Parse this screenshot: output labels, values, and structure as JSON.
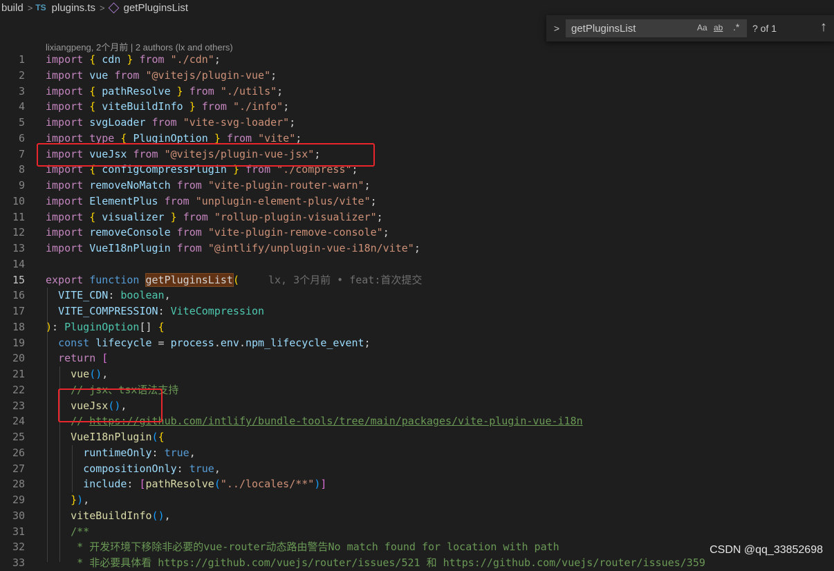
{
  "breadcrumb": {
    "folder": "build",
    "file_icon": "TS",
    "file": "plugins.ts",
    "symbol": "getPluginsList"
  },
  "find": {
    "query": "getPluginsList",
    "match_case": "Aa",
    "whole_word": "ab",
    "regex": ".*",
    "count": "? of 1"
  },
  "blame_header": "lixiangpeng, 2个月前 | 2 authors (lx and others)",
  "inline_blame": "lx, 3个月前 • feat:首次提交",
  "lines": [
    [
      [
        "c",
        "import"
      ],
      [
        "p",
        " "
      ],
      [
        "b1",
        "{"
      ],
      [
        "p",
        " "
      ],
      [
        "v",
        "cdn"
      ],
      [
        "p",
        " "
      ],
      [
        "b1",
        "}"
      ],
      [
        "p",
        " "
      ],
      [
        "c",
        "from"
      ],
      [
        "p",
        " "
      ],
      [
        "s",
        "\"./cdn\""
      ],
      [
        "p",
        ";"
      ]
    ],
    [
      [
        "c",
        "import"
      ],
      [
        "p",
        " "
      ],
      [
        "v",
        "vue"
      ],
      [
        "p",
        " "
      ],
      [
        "c",
        "from"
      ],
      [
        "p",
        " "
      ],
      [
        "s",
        "\"@vitejs/plugin-vue\""
      ],
      [
        "p",
        ";"
      ]
    ],
    [
      [
        "c",
        "import"
      ],
      [
        "p",
        " "
      ],
      [
        "b1",
        "{"
      ],
      [
        "p",
        " "
      ],
      [
        "v",
        "pathResolve"
      ],
      [
        "p",
        " "
      ],
      [
        "b1",
        "}"
      ],
      [
        "p",
        " "
      ],
      [
        "c",
        "from"
      ],
      [
        "p",
        " "
      ],
      [
        "s",
        "\"./utils\""
      ],
      [
        "p",
        ";"
      ]
    ],
    [
      [
        "c",
        "import"
      ],
      [
        "p",
        " "
      ],
      [
        "b1",
        "{"
      ],
      [
        "p",
        " "
      ],
      [
        "v",
        "viteBuildInfo"
      ],
      [
        "p",
        " "
      ],
      [
        "b1",
        "}"
      ],
      [
        "p",
        " "
      ],
      [
        "c",
        "from"
      ],
      [
        "p",
        " "
      ],
      [
        "s",
        "\"./info\""
      ],
      [
        "p",
        ";"
      ]
    ],
    [
      [
        "c",
        "import"
      ],
      [
        "p",
        " "
      ],
      [
        "v",
        "svgLoader"
      ],
      [
        "p",
        " "
      ],
      [
        "c",
        "from"
      ],
      [
        "p",
        " "
      ],
      [
        "s",
        "\"vite-svg-loader\""
      ],
      [
        "p",
        ";"
      ]
    ],
    [
      [
        "c",
        "import"
      ],
      [
        "p",
        " "
      ],
      [
        "c",
        "type"
      ],
      [
        "p",
        " "
      ],
      [
        "b1",
        "{"
      ],
      [
        "p",
        " "
      ],
      [
        "v",
        "PluginOption"
      ],
      [
        "p",
        " "
      ],
      [
        "b1",
        "}"
      ],
      [
        "p",
        " "
      ],
      [
        "c",
        "from"
      ],
      [
        "p",
        " "
      ],
      [
        "s",
        "\"vite\""
      ],
      [
        "p",
        ";"
      ]
    ],
    [
      [
        "c",
        "import"
      ],
      [
        "p",
        " "
      ],
      [
        "v",
        "vueJsx"
      ],
      [
        "p",
        " "
      ],
      [
        "c",
        "from"
      ],
      [
        "p",
        " "
      ],
      [
        "s",
        "\"@vitejs/plugin-vue-jsx\""
      ],
      [
        "p",
        ";"
      ]
    ],
    [
      [
        "c",
        "import"
      ],
      [
        "p",
        " "
      ],
      [
        "b1",
        "{"
      ],
      [
        "p",
        " "
      ],
      [
        "v",
        "configCompressPlugin"
      ],
      [
        "p",
        " "
      ],
      [
        "b1",
        "}"
      ],
      [
        "p",
        " "
      ],
      [
        "c",
        "from"
      ],
      [
        "p",
        " "
      ],
      [
        "s",
        "\"./compress\""
      ],
      [
        "p",
        ";"
      ]
    ],
    [
      [
        "c",
        "import"
      ],
      [
        "p",
        " "
      ],
      [
        "v",
        "removeNoMatch"
      ],
      [
        "p",
        " "
      ],
      [
        "c",
        "from"
      ],
      [
        "p",
        " "
      ],
      [
        "s",
        "\"vite-plugin-router-warn\""
      ],
      [
        "p",
        ";"
      ]
    ],
    [
      [
        "c",
        "import"
      ],
      [
        "p",
        " "
      ],
      [
        "v",
        "ElementPlus"
      ],
      [
        "p",
        " "
      ],
      [
        "c",
        "from"
      ],
      [
        "p",
        " "
      ],
      [
        "s",
        "\"unplugin-element-plus/vite\""
      ],
      [
        "p",
        ";"
      ]
    ],
    [
      [
        "c",
        "import"
      ],
      [
        "p",
        " "
      ],
      [
        "b1",
        "{"
      ],
      [
        "p",
        " "
      ],
      [
        "v",
        "visualizer"
      ],
      [
        "p",
        " "
      ],
      [
        "b1",
        "}"
      ],
      [
        "p",
        " "
      ],
      [
        "c",
        "from"
      ],
      [
        "p",
        " "
      ],
      [
        "s",
        "\"rollup-plugin-visualizer\""
      ],
      [
        "p",
        ";"
      ]
    ],
    [
      [
        "c",
        "import"
      ],
      [
        "p",
        " "
      ],
      [
        "v",
        "removeConsole"
      ],
      [
        "p",
        " "
      ],
      [
        "c",
        "from"
      ],
      [
        "p",
        " "
      ],
      [
        "s",
        "\"vite-plugin-remove-console\""
      ],
      [
        "p",
        ";"
      ]
    ],
    [
      [
        "c",
        "import"
      ],
      [
        "p",
        " "
      ],
      [
        "v",
        "VueI18nPlugin"
      ],
      [
        "p",
        " "
      ],
      [
        "c",
        "from"
      ],
      [
        "p",
        " "
      ],
      [
        "s",
        "\"@intlify/unplugin-vue-i18n/vite\""
      ],
      [
        "p",
        ";"
      ]
    ],
    [],
    [
      [
        "c",
        "export"
      ],
      [
        "p",
        " "
      ],
      [
        "k",
        "function"
      ],
      [
        "p",
        " "
      ],
      [
        "hl",
        "getPluginsList"
      ],
      [
        "b1",
        "("
      ],
      [
        "blame",
        ""
      ]
    ],
    [
      [
        "p",
        "  "
      ],
      [
        "v",
        "VITE_CDN"
      ],
      [
        "p",
        ": "
      ],
      [
        "t",
        "boolean"
      ],
      [
        "p",
        ","
      ]
    ],
    [
      [
        "p",
        "  "
      ],
      [
        "v",
        "VITE_COMPRESSION"
      ],
      [
        "p",
        ": "
      ],
      [
        "t",
        "ViteCompression"
      ]
    ],
    [
      [
        "b1",
        ")"
      ],
      [
        "p",
        ": "
      ],
      [
        "t",
        "PluginOption"
      ],
      [
        "p",
        "[] "
      ],
      [
        "b1",
        "{"
      ]
    ],
    [
      [
        "p",
        "  "
      ],
      [
        "k",
        "const"
      ],
      [
        "p",
        " "
      ],
      [
        "v",
        "lifecycle"
      ],
      [
        "p",
        " = "
      ],
      [
        "v",
        "process"
      ],
      [
        "p",
        "."
      ],
      [
        "v",
        "env"
      ],
      [
        "p",
        "."
      ],
      [
        "v",
        "npm_lifecycle_event"
      ],
      [
        "p",
        ";"
      ]
    ],
    [
      [
        "p",
        "  "
      ],
      [
        "c",
        "return"
      ],
      [
        "p",
        " "
      ],
      [
        "b2",
        "["
      ]
    ],
    [
      [
        "p",
        "    "
      ],
      [
        "f",
        "vue"
      ],
      [
        "b3",
        "("
      ],
      [
        "b3",
        ")"
      ],
      [
        "p",
        ","
      ]
    ],
    [
      [
        "p",
        "    "
      ],
      [
        "g",
        "// jsx、tsx语法支持"
      ]
    ],
    [
      [
        "p",
        "    "
      ],
      [
        "f",
        "vueJsx"
      ],
      [
        "b3",
        "("
      ],
      [
        "b3",
        ")"
      ],
      [
        "p",
        ","
      ]
    ],
    [
      [
        "p",
        "    "
      ],
      [
        "g",
        "// "
      ],
      [
        "gu",
        "https://github.com/intlify/bundle-tools/tree/main/packages/vite-plugin-vue-i18n"
      ]
    ],
    [
      [
        "p",
        "    "
      ],
      [
        "f",
        "VueI18nPlugin"
      ],
      [
        "b3",
        "("
      ],
      [
        "b1",
        "{"
      ]
    ],
    [
      [
        "p",
        "      "
      ],
      [
        "v",
        "runtimeOnly"
      ],
      [
        "p",
        ": "
      ],
      [
        "k",
        "true"
      ],
      [
        "p",
        ","
      ]
    ],
    [
      [
        "p",
        "      "
      ],
      [
        "v",
        "compositionOnly"
      ],
      [
        "p",
        ": "
      ],
      [
        "k",
        "true"
      ],
      [
        "p",
        ","
      ]
    ],
    [
      [
        "p",
        "      "
      ],
      [
        "v",
        "include"
      ],
      [
        "p",
        ": "
      ],
      [
        "b2",
        "["
      ],
      [
        "f",
        "pathResolve"
      ],
      [
        "b3",
        "("
      ],
      [
        "s",
        "\"../locales/**\""
      ],
      [
        "b3",
        ")"
      ],
      [
        "b2",
        "]"
      ]
    ],
    [
      [
        "p",
        "    "
      ],
      [
        "b1",
        "}"
      ],
      [
        "b3",
        ")"
      ],
      [
        "p",
        ","
      ]
    ],
    [
      [
        "p",
        "    "
      ],
      [
        "f",
        "viteBuildInfo"
      ],
      [
        "b3",
        "("
      ],
      [
        "b3",
        ")"
      ],
      [
        "p",
        ","
      ]
    ],
    [
      [
        "p",
        "    "
      ],
      [
        "g",
        "/**"
      ]
    ],
    [
      [
        "p",
        "     "
      ],
      [
        "g",
        "* 开发环境下移除非必要的vue-router动态路由警告No match found for location with path"
      ]
    ],
    [
      [
        "p",
        "     "
      ],
      [
        "g",
        "* 非必要具体看 https://github.com/vuejs/router/issues/521 和 https://github.com/vuejs/router/issues/359"
      ]
    ]
  ],
  "active_line": 15,
  "watermark": "CSDN @qq_33852698"
}
